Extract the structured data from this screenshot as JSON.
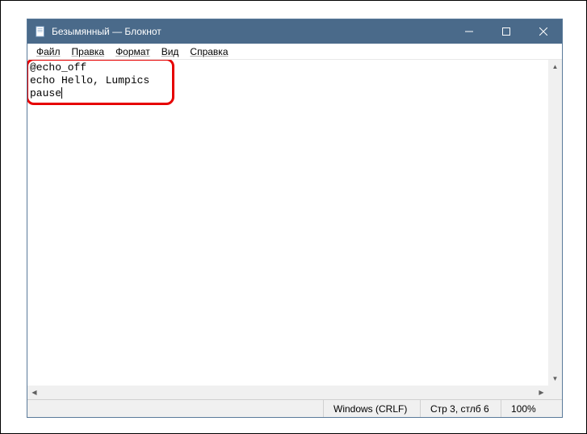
{
  "window": {
    "title": "Безымянный — Блокнот"
  },
  "menu": {
    "file": "Файл",
    "edit": "Правка",
    "format": "Формат",
    "view": "Вид",
    "help": "Справка"
  },
  "editor": {
    "content": "@echo_off\necho Hello, Lumpics\npause"
  },
  "statusbar": {
    "encoding": "Windows (CRLF)",
    "position": "Стр 3, стлб 6",
    "zoom": "100%"
  }
}
